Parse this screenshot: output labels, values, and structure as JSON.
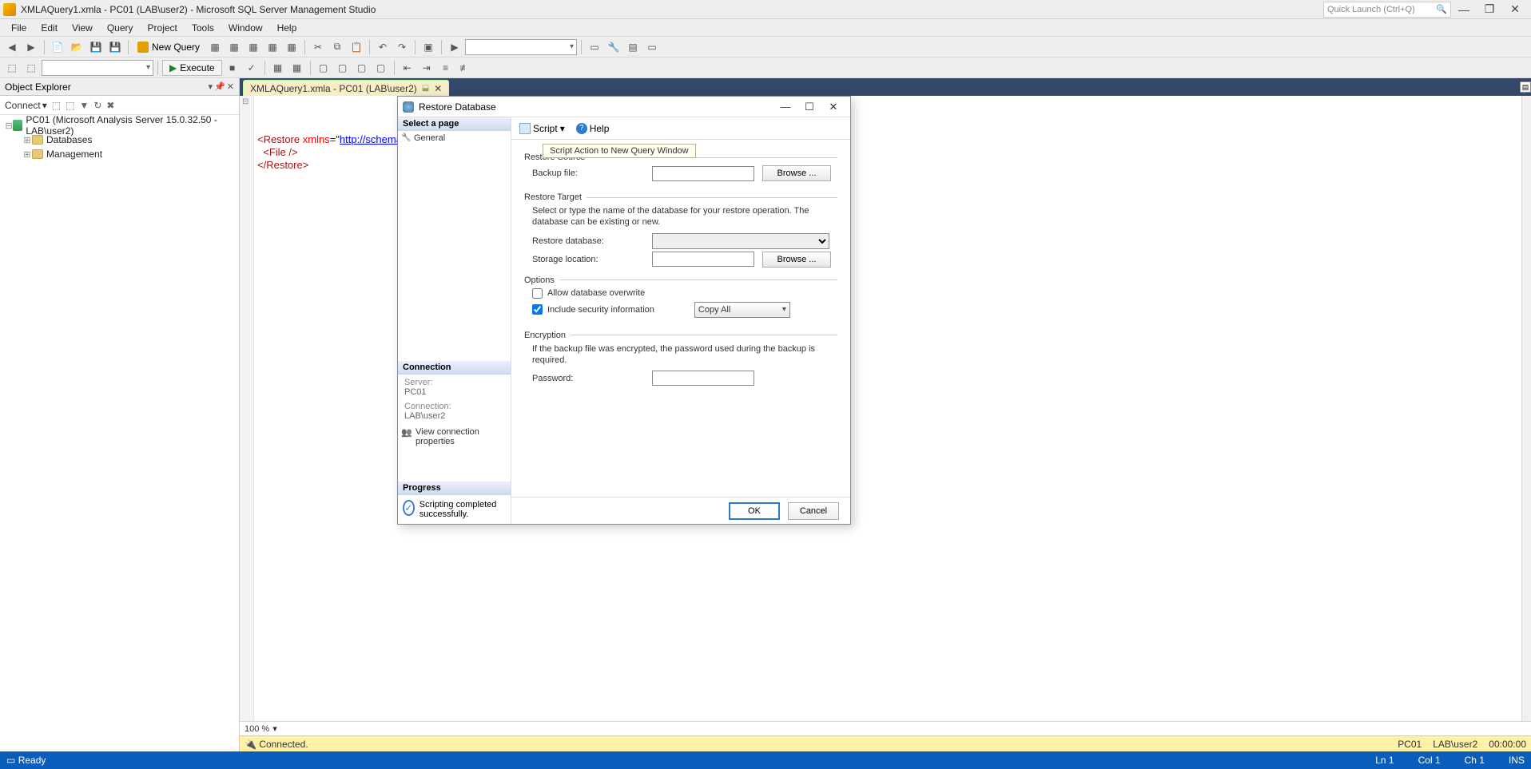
{
  "titlebar": {
    "title": "XMLAQuery1.xmla - PC01 (LAB\\user2) - Microsoft SQL Server Management Studio",
    "quick_launch_placeholder": "Quick Launch (Ctrl+Q)"
  },
  "menubar": [
    "File",
    "Edit",
    "View",
    "Query",
    "Project",
    "Tools",
    "Window",
    "Help"
  ],
  "toolbar": {
    "new_query": "New Query",
    "execute": "Execute"
  },
  "object_explorer": {
    "title": "Object Explorer",
    "connect_label": "Connect",
    "root": "PC01 (Microsoft Analysis Server 15.0.32.50 - LAB\\user2)",
    "children": [
      "Databases",
      "Management"
    ]
  },
  "editor": {
    "tab_label": "XMLAQuery1.xmla - PC01 (LAB\\user2)",
    "code_line1_a": "<Restore",
    "code_line1_attr": " xmlns",
    "code_line1_eq": "=\"",
    "code_line1_url": "http://schemas.microsoft.com/analysisservices/2003/engine",
    "code_line1_b": "\">",
    "code_line2": "  <File />",
    "code_line3": "</Restore>",
    "zoom": "100 %",
    "connected": "Connected.",
    "server_cell": "PC01",
    "user_cell": "LAB\\user2",
    "time_cell": "00:00:00"
  },
  "statusbar": {
    "ready": "Ready",
    "ln": "Ln 1",
    "col": "Col 1",
    "ch": "Ch 1",
    "ins": "INS"
  },
  "dialog": {
    "title": "Restore Database",
    "select_page": "Select a page",
    "general": "General",
    "connection_hdr": "Connection",
    "server_lbl": "Server:",
    "server_val": "PC01",
    "conn_lbl": "Connection:",
    "conn_val": "LAB\\user2",
    "view_conn": "View connection properties",
    "progress_hdr": "Progress",
    "progress_msg": "Scripting completed successfully.",
    "toolbar_script": "Script",
    "toolbar_help": "Help",
    "tooltip": "Script Action to New Query Window",
    "restore_source": "Restore Source",
    "backup_file": "Backup file:",
    "browse": "Browse ...",
    "restore_target": "Restore Target",
    "target_desc": "Select or type the name of the database for your restore operation. The database can be existing or new.",
    "restore_db": "Restore database:",
    "storage_loc": "Storage location:",
    "options": "Options",
    "allow_overwrite": "Allow database overwrite",
    "include_sec": "Include security information",
    "sec_mode": "Copy All",
    "encryption": "Encryption",
    "enc_desc": "If the backup file was encrypted, the password used during the backup is required.",
    "password": "Password:",
    "ok": "OK",
    "cancel": "Cancel"
  }
}
